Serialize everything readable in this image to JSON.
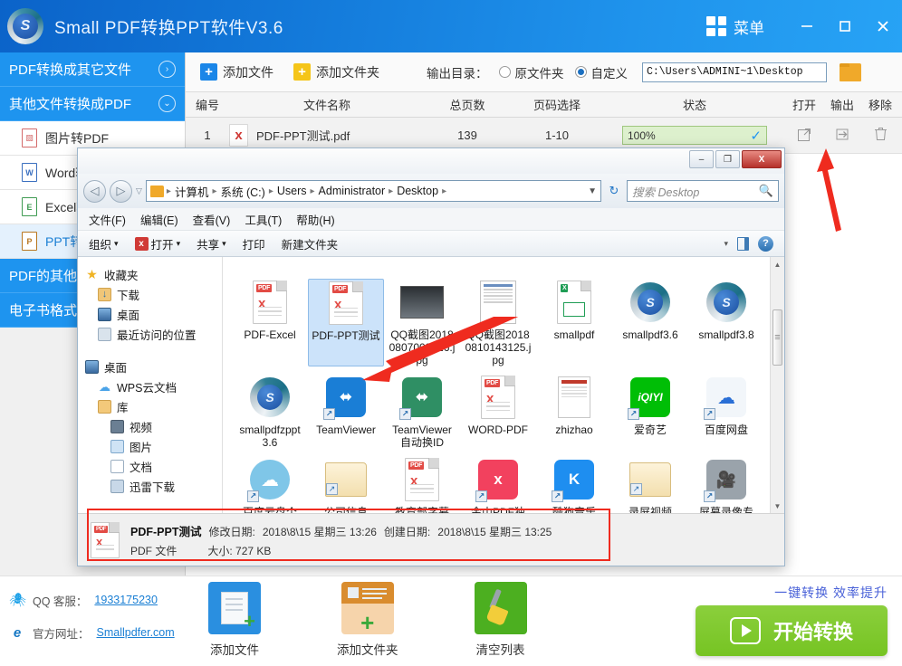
{
  "titlebar": {
    "app_title": "Small PDF转换PPT软件V3.6",
    "logo_letter": "S",
    "menu_label": "菜单",
    "minimize": "–",
    "maximize": "□",
    "close": "✕"
  },
  "sidebar": {
    "groups": [
      {
        "label": "PDF转换成其它文件",
        "chevron": "›",
        "expanded": false
      },
      {
        "label": "其他文件转换成PDF",
        "chevron": "⌄",
        "expanded": true
      }
    ],
    "items": [
      {
        "label": "图片转PDF",
        "icon": "image-file-icon",
        "glyph": "▨",
        "active": false
      },
      {
        "label": "Word转PDF",
        "icon": "word-file-icon",
        "glyph": "W",
        "active": false
      },
      {
        "label": "Excel转PDF",
        "icon": "excel-file-icon",
        "glyph": "E",
        "active": false
      },
      {
        "label": "PPT转PDF",
        "icon": "ppt-file-icon",
        "glyph": "P",
        "active": true
      }
    ],
    "groups_bottom": [
      {
        "label": "PDF的其他功能",
        "chevron": ""
      },
      {
        "label": "电子书格式转换",
        "chevron": ""
      }
    ]
  },
  "toolbar": {
    "add_file": "添加文件",
    "add_folder": "添加文件夹",
    "output_dir_label": "输出目录：",
    "radio_original": "原文件夹",
    "radio_custom": "自定义",
    "selected_radio": "自定义",
    "path_value": "C:\\Users\\ADMINI~1\\Desktop",
    "browse_icon": "folder-icon"
  },
  "table": {
    "headers": [
      "编号",
      "文件名称",
      "总页数",
      "页码选择",
      "状态",
      "打开",
      "输出",
      "移除"
    ],
    "rows": [
      {
        "no": "1",
        "filename": "PDF-PPT测试.pdf",
        "pages": "139",
        "range": "1-10",
        "status": "100%",
        "status_check": "✓",
        "open_icon": "open-external-icon",
        "output_icon": "export-icon",
        "delete_icon": "trash-icon"
      }
    ]
  },
  "explorer": {
    "caption": {
      "minimize": "–",
      "maximize": "❐",
      "close": "X"
    },
    "nav": {
      "back": "◁",
      "forward": "▷",
      "dropdown": "▽"
    },
    "breadcrumb": [
      "计算机",
      "系统 (C:)",
      "Users",
      "Administrator",
      "Desktop"
    ],
    "breadcrumb_sep": "▸",
    "breadcrumb_dropdown": "▼",
    "refresh_icon": "refresh-icon",
    "refresh_glyph": "↻",
    "search_placeholder": "搜索 Desktop",
    "search_icon": "search-icon",
    "menus": [
      "文件(F)",
      "编辑(E)",
      "查看(V)",
      "工具(T)",
      "帮助(H)"
    ],
    "commands": [
      {
        "label": "组织",
        "caret": "▾",
        "icon": ""
      },
      {
        "label": "打开",
        "caret": "▾",
        "icon": "pdf-open-icon"
      },
      {
        "label": "共享",
        "caret": "▾",
        "icon": ""
      },
      {
        "label": "打印",
        "caret": "",
        "icon": ""
      },
      {
        "label": "新建文件夹",
        "caret": "",
        "icon": ""
      }
    ],
    "command_right": {
      "view_icon": "view-grid-icon",
      "view_caret": "▾",
      "pane_icon": "preview-pane-icon",
      "help_icon": "help-icon",
      "help_glyph": "?"
    },
    "nav_tree": [
      {
        "label": "收藏夹",
        "level": 1,
        "icon": "favorites-star-icon"
      },
      {
        "label": "下载",
        "level": 2,
        "icon": "downloads-icon"
      },
      {
        "label": "桌面",
        "level": 2,
        "icon": "desktop-icon"
      },
      {
        "label": "最近访问的位置",
        "level": 2,
        "icon": "recent-places-icon"
      },
      {
        "label": "桌面",
        "level": 1,
        "icon": "desktop-icon"
      },
      {
        "label": "WPS云文档",
        "level": 2,
        "icon": "wps-cloud-icon"
      },
      {
        "label": "库",
        "level": 2,
        "icon": "library-icon"
      },
      {
        "label": "视频",
        "level": 3,
        "icon": "video-icon"
      },
      {
        "label": "图片",
        "level": 3,
        "icon": "pictures-icon"
      },
      {
        "label": "文档",
        "level": 3,
        "icon": "documents-icon"
      },
      {
        "label": "迅雷下载",
        "level": 3,
        "icon": "thunder-download-icon"
      }
    ],
    "files_row1": [
      {
        "name": "PDF-Excel",
        "type": "pdf",
        "selected": false
      },
      {
        "name": "PDF-PPT测试",
        "type": "pdf",
        "selected": true
      },
      {
        "name": "QQ截图20180807003726.jpg",
        "type": "photo",
        "selected": false
      },
      {
        "name": "QQ截图20180810143125.jpg",
        "type": "screenshot",
        "selected": false
      },
      {
        "name": "smallpdf",
        "type": "excel",
        "selected": false
      },
      {
        "name": "smallpdf3.6",
        "type": "smallpdf",
        "selected": false
      },
      {
        "name": "smallpdf3.8",
        "type": "smallpdf",
        "selected": false
      }
    ],
    "files_row2": [
      {
        "name": "smallpdfzppt3.6",
        "type": "smallpdf",
        "shortcut": false
      },
      {
        "name": "TeamViewer",
        "type": "teamviewer-blue",
        "shortcut": true
      },
      {
        "name": "TeamViewer自动换ID",
        "type": "teamviewer-green",
        "shortcut": true
      },
      {
        "name": "WORD-PDF",
        "type": "pdf",
        "shortcut": false
      },
      {
        "name": "zhizhao",
        "type": "certificate",
        "shortcut": false
      },
      {
        "name": "爱奇艺",
        "type": "iqiyi",
        "shortcut": true
      },
      {
        "name": "百度网盘",
        "type": "baidu-pan",
        "shortcut": true
      }
    ],
    "files_row3": [
      {
        "name": "百度云盘个",
        "type": "baidu-cloud",
        "shortcut": true
      },
      {
        "name": "公司信息",
        "type": "folder-docs",
        "shortcut": true
      },
      {
        "name": "教育部字幕",
        "type": "pdf",
        "shortcut": false
      },
      {
        "name": "金山PDF独",
        "type": "kingsoft-pdf",
        "shortcut": true
      },
      {
        "name": "酷狗音乐",
        "type": "kugou",
        "shortcut": true
      },
      {
        "name": "录屏视频",
        "type": "folder-open",
        "shortcut": true
      },
      {
        "name": "屏幕录像专",
        "type": "screen-recorder",
        "shortcut": true
      }
    ],
    "details": {
      "file_name": "PDF-PPT测试",
      "modified_label": "修改日期:",
      "modified_value": "2018\\8\\15 星期三 13:26",
      "created_label": "创建日期:",
      "created_value": "2018\\8\\15 星期三 13:25",
      "file_type": "PDF 文件",
      "size_label": "大小:",
      "size_value": "727 KB"
    },
    "scrollbar": {
      "up": "▲",
      "down": "▼",
      "grip": "≡"
    }
  },
  "bottom": {
    "qq_label": "QQ 客服：",
    "qq_value": "1933175230",
    "site_label": "官方网址：",
    "site_value": "Smallpdfer.com",
    "actions": [
      {
        "label": "添加文件",
        "icon": "add-file-icon"
      },
      {
        "label": "添加文件夹",
        "icon": "add-folder-icon"
      },
      {
        "label": "清空列表",
        "icon": "clear-list-icon"
      }
    ],
    "promo": "一键转换 效率提升",
    "convert_label": "开始转换",
    "convert_icon": "play-icon"
  },
  "annotations": {
    "arrow_to_output": "red-arrow-output",
    "arrow_to_file": "red-arrow-file",
    "box_details": "red-box-details"
  },
  "colors": {
    "accent": "#1e94ef",
    "titlebar": "#1277d8",
    "convert_green": "#76c423",
    "annotation_red": "#ef2b1f",
    "progress_green": "#ddf0cd"
  }
}
